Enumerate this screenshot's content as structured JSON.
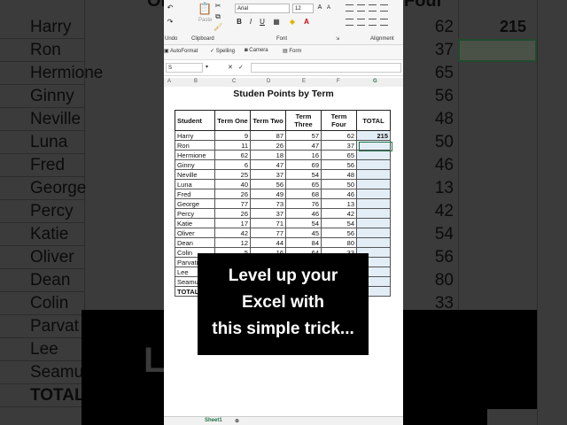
{
  "background": {
    "header_text": "Four",
    "header_left": "Or",
    "names": [
      "Harry",
      "Ron",
      "Hermione",
      "Ginny",
      "Neville",
      "Luna",
      "Fred",
      "George",
      "Percy",
      "Katie",
      "Oliver",
      "Dean",
      "Colin",
      "Parvat",
      "Lee",
      "Seamu",
      "TOTAL"
    ],
    "numbers": [
      "62",
      "37",
      "65",
      "56",
      "48",
      "50",
      "46",
      "13",
      "42",
      "54",
      "56",
      "80",
      "33"
    ],
    "total_value": "215",
    "overlay_text": "Level up your Excel with this simple trick..."
  },
  "ribbon": {
    "font_name": "Arial",
    "font_size": "12",
    "undo_label": "Undo",
    "clipboard_label": "Clipboard",
    "paste_label": "Paste",
    "font_label": "Font",
    "alignment_label": "Alignment",
    "bold": "B",
    "italic": "I",
    "underline": "U",
    "font_color_btn": "A"
  },
  "subbar": {
    "autoformat": "AutoFormat",
    "spelling": "Spelling",
    "camera": "Camera",
    "form": "Form"
  },
  "formula_bar": {
    "name_box": "S"
  },
  "columns": [
    "A",
    "B",
    "C",
    "D",
    "E",
    "F",
    "G"
  ],
  "sheet": {
    "title": "Studen Points by Term",
    "headers": [
      "Student",
      "Term One",
      "Term Two",
      "Term Three",
      "Term Four",
      "TOTAL"
    ],
    "rows": [
      {
        "name": "Harry",
        "t1": "9",
        "t2": "87",
        "t3": "57",
        "t4": "62",
        "total": "215"
      },
      {
        "name": "Ron",
        "t1": "11",
        "t2": "26",
        "t3": "47",
        "t4": "37",
        "total": ""
      },
      {
        "name": "Hermione",
        "t1": "62",
        "t2": "18",
        "t3": "16",
        "t4": "65",
        "total": ""
      },
      {
        "name": "Ginny",
        "t1": "6",
        "t2": "47",
        "t3": "69",
        "t4": "56",
        "total": ""
      },
      {
        "name": "Neville",
        "t1": "25",
        "t2": "37",
        "t3": "54",
        "t4": "48",
        "total": ""
      },
      {
        "name": "Luna",
        "t1": "40",
        "t2": "56",
        "t3": "65",
        "t4": "50",
        "total": ""
      },
      {
        "name": "Fred",
        "t1": "26",
        "t2": "49",
        "t3": "68",
        "t4": "46",
        "total": ""
      },
      {
        "name": "George",
        "t1": "77",
        "t2": "73",
        "t3": "76",
        "t4": "13",
        "total": ""
      },
      {
        "name": "Percy",
        "t1": "26",
        "t2": "37",
        "t3": "46",
        "t4": "42",
        "total": ""
      },
      {
        "name": "Katie",
        "t1": "17",
        "t2": "71",
        "t3": "54",
        "t4": "54",
        "total": ""
      },
      {
        "name": "Oliver",
        "t1": "42",
        "t2": "77",
        "t3": "45",
        "t4": "56",
        "total": ""
      },
      {
        "name": "Dean",
        "t1": "12",
        "t2": "44",
        "t3": "84",
        "t4": "80",
        "total": ""
      },
      {
        "name": "Colin",
        "t1": "5",
        "t2": "16",
        "t3": "64",
        "t4": "33",
        "total": ""
      },
      {
        "name": "Parvati",
        "t1": "",
        "t2": "",
        "t3": "",
        "t4": "",
        "total": ""
      },
      {
        "name": "Lee",
        "t1": "",
        "t2": "",
        "t3": "",
        "t4": "",
        "total": ""
      },
      {
        "name": "Seamus",
        "t1": "",
        "t2": "",
        "t3": "",
        "t4": "",
        "total": ""
      }
    ],
    "total_label": "TOTAL"
  },
  "tabs": {
    "sheet1": "Sheet1"
  },
  "caption": {
    "line1": "Level up your",
    "line2": "Excel with",
    "line3": "this simple trick..."
  }
}
